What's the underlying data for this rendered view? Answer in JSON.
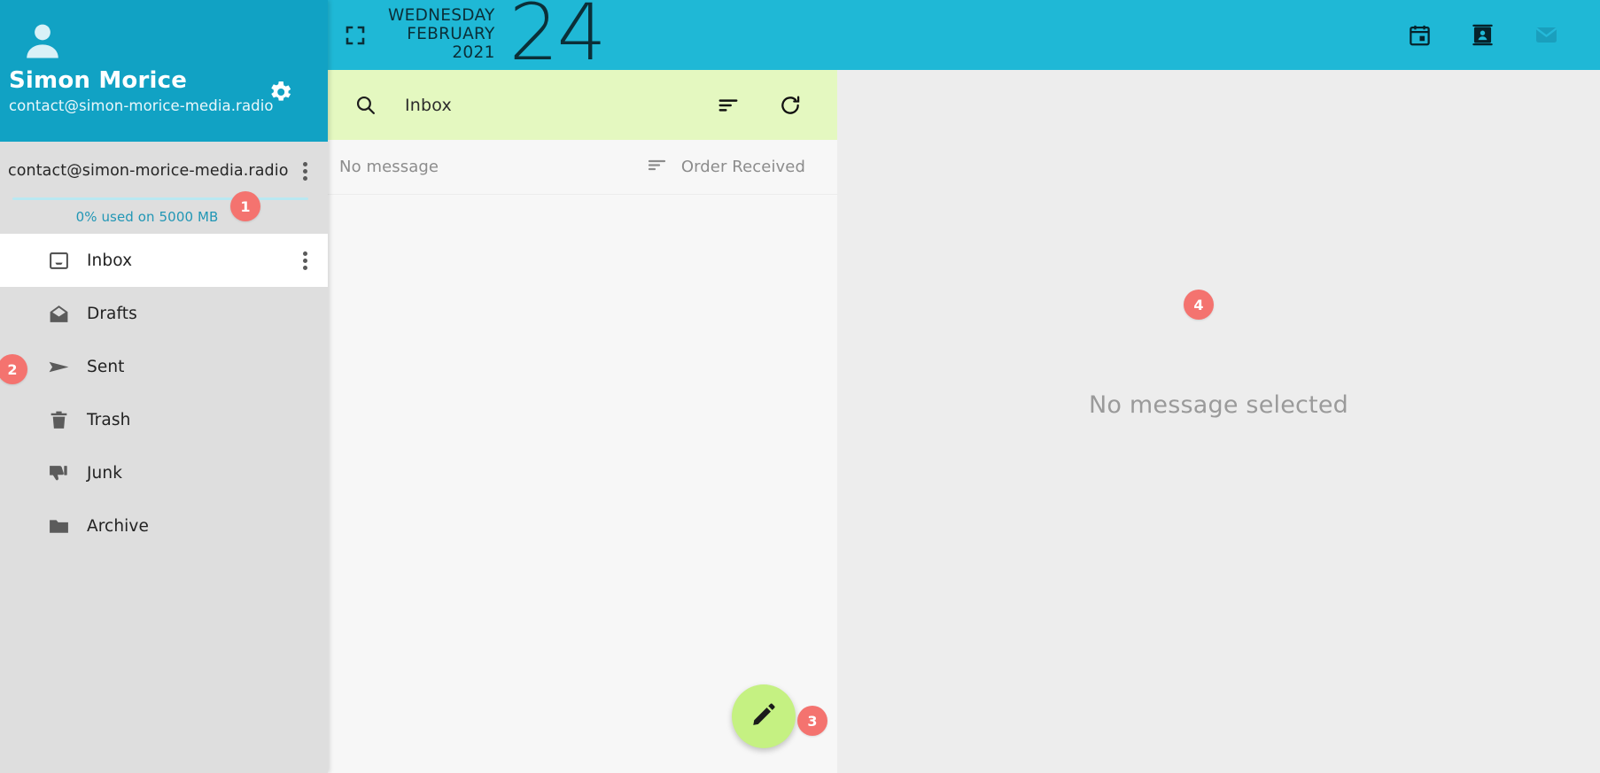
{
  "topbar": {
    "expand_icon": "fullscreen-expand-icon",
    "date_weekday": "WEDNESDAY",
    "date_month": "FEBRUARY",
    "date_year": "2021",
    "date_day": "24",
    "icons": [
      {
        "name": "calendar-icon",
        "label": "Calendar",
        "active": false
      },
      {
        "name": "contacts-icon",
        "label": "Contacts",
        "active": false
      },
      {
        "name": "mail-icon",
        "label": "Mail",
        "active": true
      }
    ],
    "bg_color": "#1fb8d6"
  },
  "sidebar": {
    "profile": {
      "avatar_icon": "user-avatar-icon",
      "name": "Simon Morice",
      "email": "contact@simon-morice-media.radio",
      "settings_icon": "gear-icon",
      "bg_color": "#11a2c4"
    },
    "account": {
      "email": "contact@simon-morice-media.radio",
      "menu_icon": "kebab-menu-icon",
      "quota_text": "0% used on 5000 MB",
      "quota_percent": 0,
      "quota_total": "5000 MB",
      "quota_color": "#2196b5"
    },
    "folders": [
      {
        "label": "Inbox",
        "icon": "inbox-icon",
        "active": true,
        "has_menu": true
      },
      {
        "label": "Drafts",
        "icon": "drafts-envelope-icon",
        "active": false,
        "has_menu": false
      },
      {
        "label": "Sent",
        "icon": "sent-paper-plane-icon",
        "active": false,
        "has_menu": false
      },
      {
        "label": "Trash",
        "icon": "trash-icon",
        "active": false,
        "has_menu": false
      },
      {
        "label": "Junk",
        "icon": "thumbs-down-icon",
        "active": false,
        "has_menu": false
      },
      {
        "label": "Archive",
        "icon": "folder-icon",
        "active": false,
        "has_menu": false
      }
    ],
    "bg_color": "#dedede"
  },
  "message_list": {
    "search": {
      "icon": "search-icon",
      "value": "Inbox",
      "placeholder": "Search",
      "bg_color": "#e4f8c0"
    },
    "toolbar": [
      {
        "name": "filter-sort-icon",
        "label": "Filter"
      },
      {
        "name": "refresh-icon",
        "label": "Refresh"
      }
    ],
    "header": {
      "count_text": "No message",
      "sort_icon": "sort-icon",
      "sort_label": "Order Received"
    },
    "items": [],
    "compose": {
      "icon": "pencil-compose-icon",
      "label": "Compose",
      "color": "#c5f182"
    }
  },
  "reading_pane": {
    "empty_text": "No message selected",
    "bg_color": "#ededed"
  },
  "annotations": [
    {
      "id": 1,
      "label": "1"
    },
    {
      "id": 2,
      "label": "2"
    },
    {
      "id": 3,
      "label": "3"
    },
    {
      "id": 4,
      "label": "4"
    }
  ]
}
